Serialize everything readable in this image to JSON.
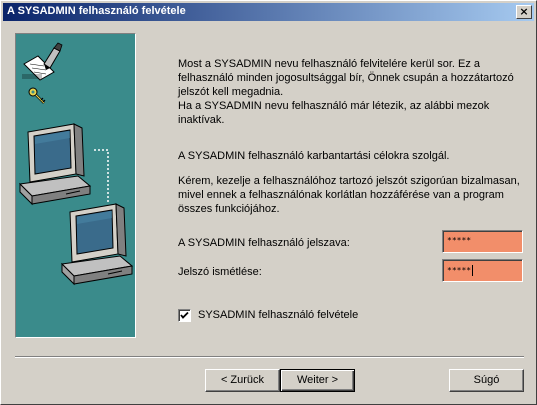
{
  "window": {
    "title": "A SYSADMIN felhasználó felvétele",
    "close_label": "×"
  },
  "content": {
    "paragraphs": [
      "Most a SYSADMIN nevu felhasználó felvitelére kerül sor. Ez a felhasználó minden jogosultsággal bír, Önnek csupán a hozzátartozó jelszót kell megadnia.",
      "Ha a  SYSADMIN nevu felhasználó már létezik, az alábbi mezok inaktívak.",
      "A SYSADMIN felhasználó karbantartási célokra szolgál.",
      "Kérem, kezelje a felhasználóhoz tartozó jelszót  szigorúan bizalmasan, mivel ennek a felhasználónak korlátlan hozzáférése van a program összes funkciójához."
    ],
    "password_label": "A SYSADMIN felhasználó jelszava:",
    "password_value": "*****",
    "password_repeat_label": "Jelszó ismétlése:",
    "password_repeat_value": "*****",
    "checkbox_label": "SYSADMIN felhasználó felvétele",
    "checkbox_checked": true
  },
  "buttons": {
    "back": "< Zurück",
    "next": "Weiter >",
    "help": "Súgó"
  },
  "colors": {
    "panel": "#3a8b8b",
    "password_field": "#f28e6a",
    "title_start": "#0a246a",
    "title_end": "#a6caf0"
  },
  "icons": [
    "document-pen-icon",
    "key-icon",
    "computer-icon",
    "computer-icon"
  ]
}
